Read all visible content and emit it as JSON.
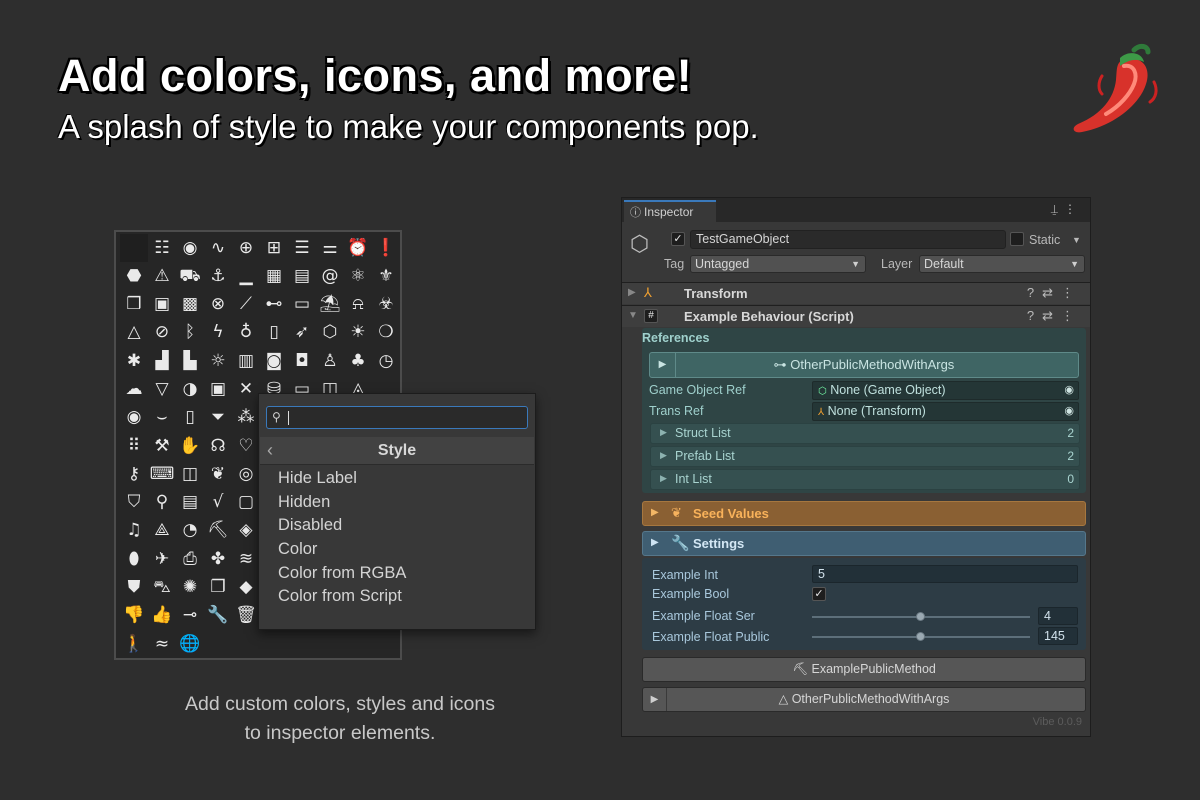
{
  "hero": {
    "title": "Add colors, icons, and more!",
    "subtitle": "A splash of style to make your components pop."
  },
  "caption": {
    "line1": "Add custom colors, styles and icons",
    "line2": "to inspector elements."
  },
  "icon_grid": {
    "icons": [
      {
        "name": "blank-icon",
        "glyph": ""
      },
      {
        "name": "abacus-icon",
        "glyph": "☷"
      },
      {
        "name": "broadcast-icon",
        "glyph": "◉"
      },
      {
        "name": "activity-icon",
        "glyph": "∿"
      },
      {
        "name": "add-circle-icon",
        "glyph": "⊕"
      },
      {
        "name": "add-box-icon",
        "glyph": "⊞"
      },
      {
        "name": "playlist-add-icon",
        "glyph": "☰"
      },
      {
        "name": "sliders-icon",
        "glyph": "⚌"
      },
      {
        "name": "alarm-icon",
        "glyph": "⏰"
      },
      {
        "name": "alert-circle-icon",
        "glyph": "❗"
      },
      {
        "name": "alert-octagon-icon",
        "glyph": "⬣"
      },
      {
        "name": "warning-icon",
        "glyph": "⚠"
      },
      {
        "name": "ambulance-icon",
        "glyph": "⛟"
      },
      {
        "name": "anchor-icon",
        "glyph": "⚓"
      },
      {
        "name": "signal-bars-icon",
        "glyph": "▁"
      },
      {
        "name": "apps-icon",
        "glyph": "▦"
      },
      {
        "name": "archive-icon",
        "glyph": "▤"
      },
      {
        "name": "at-sign-icon",
        "glyph": "@"
      },
      {
        "name": "atom-icon",
        "glyph": "⚛"
      },
      {
        "name": "award-icon",
        "glyph": "⚜"
      },
      {
        "name": "badge-3d-icon",
        "glyph": "❒"
      },
      {
        "name": "badge-ar-icon",
        "glyph": "▣"
      },
      {
        "name": "badge-vr-icon",
        "glyph": "▩"
      },
      {
        "name": "basketball-icon",
        "glyph": "⊗"
      },
      {
        "name": "bandage-icon",
        "glyph": "⟋"
      },
      {
        "name": "barbell-icon",
        "glyph": "⊷"
      },
      {
        "name": "battery-icon",
        "glyph": "▭"
      },
      {
        "name": "beach-icon",
        "glyph": "⛱"
      },
      {
        "name": "bell-ringing-icon",
        "glyph": "⍾"
      },
      {
        "name": "biohazard-icon",
        "glyph": "☣"
      },
      {
        "name": "triangle-icon",
        "glyph": "△"
      },
      {
        "name": "ban-icon",
        "glyph": "⊘"
      },
      {
        "name": "bluetooth-icon",
        "glyph": "ᛒ"
      },
      {
        "name": "bolt-icon",
        "glyph": "ϟ"
      },
      {
        "name": "bomb-icon",
        "glyph": "♁"
      },
      {
        "name": "book-icon",
        "glyph": "▯"
      },
      {
        "name": "rocket-icon",
        "glyph": "➶"
      },
      {
        "name": "box-icon",
        "glyph": "⬡"
      },
      {
        "name": "brightness-icon",
        "glyph": "☀"
      },
      {
        "name": "chat-bubble-icon",
        "glyph": "❍"
      },
      {
        "name": "bug-icon",
        "glyph": "✱"
      },
      {
        "name": "buildings-icon",
        "glyph": "▟"
      },
      {
        "name": "factory-icon",
        "glyph": "▙"
      },
      {
        "name": "bulb-icon",
        "glyph": "☼"
      },
      {
        "name": "calendar-icon",
        "glyph": "▥"
      },
      {
        "name": "camera-icon",
        "glyph": "◙"
      },
      {
        "name": "gamepad-icon",
        "glyph": "◘"
      },
      {
        "name": "chess-pawn-icon",
        "glyph": "♙"
      },
      {
        "name": "tree-icon",
        "glyph": "♣"
      },
      {
        "name": "clock-icon",
        "glyph": "◷"
      },
      {
        "name": "cloud-icon",
        "glyph": "☁"
      },
      {
        "name": "funnel-down-icon",
        "glyph": "▽"
      },
      {
        "name": "contrast-icon",
        "glyph": "◑"
      },
      {
        "name": "cpu-icon",
        "glyph": "▣"
      },
      {
        "name": "close-icon",
        "glyph": "✕"
      },
      {
        "name": "database-icon",
        "glyph": "⛁"
      },
      {
        "name": "desktop-icon",
        "glyph": "▭"
      },
      {
        "name": "ticket-icon",
        "glyph": "◫"
      },
      {
        "name": "droplet-icon",
        "glyph": "◬"
      },
      {
        "name": "blank-2-icon",
        "glyph": ""
      },
      {
        "name": "eye-icon",
        "glyph": "◉"
      },
      {
        "name": "eye-closed-icon",
        "glyph": "⌣"
      },
      {
        "name": "file-icon",
        "glyph": "▯"
      },
      {
        "name": "filter-icon",
        "glyph": "⏷"
      },
      {
        "name": "shapes-icon",
        "glyph": "⁂"
      },
      {
        "name": "blank-3-icon",
        "glyph": ""
      },
      {
        "name": "blank-4-icon",
        "glyph": ""
      },
      {
        "name": "blank-5-icon",
        "glyph": ""
      },
      {
        "name": "blank-6-icon",
        "glyph": ""
      },
      {
        "name": "blank-7-icon",
        "glyph": ""
      },
      {
        "name": "grid-dots-icon",
        "glyph": "⠿"
      },
      {
        "name": "gavel-icon",
        "glyph": "⚒"
      },
      {
        "name": "hand-icon",
        "glyph": "✋"
      },
      {
        "name": "headphones-icon",
        "glyph": "☊"
      },
      {
        "name": "heart-icon",
        "glyph": "♡"
      },
      {
        "name": "blank-8-icon",
        "glyph": ""
      },
      {
        "name": "blank-9-icon",
        "glyph": ""
      },
      {
        "name": "blank-10-icon",
        "glyph": ""
      },
      {
        "name": "blank-11-icon",
        "glyph": ""
      },
      {
        "name": "blank-12-icon",
        "glyph": ""
      },
      {
        "name": "key-icon",
        "glyph": "⚷"
      },
      {
        "name": "keyboard-icon",
        "glyph": "⌨"
      },
      {
        "name": "layout-columns-icon",
        "glyph": "◫"
      },
      {
        "name": "leaf-icon",
        "glyph": "❦"
      },
      {
        "name": "lifebuoy-icon",
        "glyph": "◎"
      },
      {
        "name": "blank-13-icon",
        "glyph": ""
      },
      {
        "name": "blank-14-icon",
        "glyph": ""
      },
      {
        "name": "blank-15-icon",
        "glyph": ""
      },
      {
        "name": "blank-16-icon",
        "glyph": ""
      },
      {
        "name": "blank-17-icon",
        "glyph": ""
      },
      {
        "name": "map-icon",
        "glyph": "⛉"
      },
      {
        "name": "map-pin-icon",
        "glyph": "⚲"
      },
      {
        "name": "message-language-icon",
        "glyph": "▤"
      },
      {
        "name": "math-icon",
        "glyph": "√"
      },
      {
        "name": "message-icon",
        "glyph": "▢"
      },
      {
        "name": "blank-18-icon",
        "glyph": ""
      },
      {
        "name": "blank-19-icon",
        "glyph": ""
      },
      {
        "name": "blank-20-icon",
        "glyph": ""
      },
      {
        "name": "blank-21-icon",
        "glyph": ""
      },
      {
        "name": "blank-22-icon",
        "glyph": ""
      },
      {
        "name": "music-icon",
        "glyph": "♫"
      },
      {
        "name": "triangle-outline-icon",
        "glyph": "⟁"
      },
      {
        "name": "pacman-icon",
        "glyph": "◔"
      },
      {
        "name": "paint-roller-icon",
        "glyph": "⛏"
      },
      {
        "name": "diamond-icon",
        "glyph": "◈"
      },
      {
        "name": "blank-23-icon",
        "glyph": ""
      },
      {
        "name": "blank-24-icon",
        "glyph": ""
      },
      {
        "name": "blank-25-icon",
        "glyph": ""
      },
      {
        "name": "blank-26-icon",
        "glyph": ""
      },
      {
        "name": "blank-27-icon",
        "glyph": ""
      },
      {
        "name": "pill-icon",
        "glyph": "⬮"
      },
      {
        "name": "plane-icon",
        "glyph": "✈"
      },
      {
        "name": "printer-icon",
        "glyph": "⎙"
      },
      {
        "name": "puzzle-icon",
        "glyph": "✤"
      },
      {
        "name": "wave-icon",
        "glyph": "≋"
      },
      {
        "name": "blank-28-icon",
        "glyph": ""
      },
      {
        "name": "blank-29-icon",
        "glyph": ""
      },
      {
        "name": "blank-30-icon",
        "glyph": ""
      },
      {
        "name": "blank-31-icon",
        "glyph": ""
      },
      {
        "name": "blank-32-icon",
        "glyph": ""
      },
      {
        "name": "shirt-icon",
        "glyph": "⛊"
      },
      {
        "name": "shopping-cart-icon",
        "glyph": "⛍"
      },
      {
        "name": "spider-icon",
        "glyph": "✺"
      },
      {
        "name": "copy-icon",
        "glyph": "❐"
      },
      {
        "name": "stack-icon",
        "glyph": "◆"
      },
      {
        "name": "blank-33-icon",
        "glyph": ""
      },
      {
        "name": "blank-34-icon",
        "glyph": ""
      },
      {
        "name": "blank-35-icon",
        "glyph": ""
      },
      {
        "name": "blank-36-icon",
        "glyph": ""
      },
      {
        "name": "blank-37-icon",
        "glyph": ""
      },
      {
        "name": "thumb-down-icon",
        "glyph": "👎"
      },
      {
        "name": "thumb-up-icon",
        "glyph": "👍"
      },
      {
        "name": "toggle-icon",
        "glyph": "⊸"
      },
      {
        "name": "wrench-icon",
        "glyph": "🔧"
      },
      {
        "name": "trash-icon",
        "glyph": "🗑"
      },
      {
        "name": "blank-38-icon",
        "glyph": ""
      },
      {
        "name": "blank-39-icon",
        "glyph": ""
      },
      {
        "name": "blank-40-icon",
        "glyph": ""
      },
      {
        "name": "blank-41-icon",
        "glyph": ""
      },
      {
        "name": "blank-42-icon",
        "glyph": ""
      },
      {
        "name": "walk-icon",
        "glyph": "🚶"
      },
      {
        "name": "wind-icon",
        "glyph": "≈"
      },
      {
        "name": "world-icon",
        "glyph": "🌐"
      }
    ]
  },
  "popup": {
    "header": "Style",
    "items": [
      "Hide Label",
      "Hidden",
      "Disabled",
      "Color",
      "Color from RGBA",
      "Color from Script"
    ]
  },
  "inspector": {
    "tab_label": "Inspector",
    "object_name": "TestGameObject",
    "static_label": "Static",
    "tag_label": "Tag",
    "tag_value": "Untagged",
    "layer_label": "Layer",
    "layer_value": "Default",
    "transform_label": "Transform",
    "behaviour_label": "Example Behaviour (Script)",
    "references_title": "References",
    "method_button_top": "OtherPublicMethodWithArgs",
    "game_object_ref_label": "Game Object Ref",
    "game_object_ref_value": "None (Game Object)",
    "trans_ref_label": "Trans Ref",
    "trans_ref_value": "None (Transform)",
    "lists": [
      {
        "label": "Struct List",
        "count": "2"
      },
      {
        "label": "Prefab List",
        "count": "2"
      },
      {
        "label": "Int List",
        "count": "0"
      }
    ],
    "seed_values_label": "Seed Values",
    "settings_label": "Settings",
    "example_int_label": "Example Int",
    "example_int_value": "5",
    "example_bool_label": "Example Bool",
    "example_float_ser_label": "Example Float Ser",
    "example_float_ser_value": "4",
    "example_float_public_label": "Example Float Public",
    "example_float_public_value": "145",
    "example_public_method": "ExamplePublicMethod",
    "method_button_bottom": "OtherPublicMethodWithArgs",
    "version": "Vibe 0.0.9"
  },
  "colors": {
    "background": "#2e2e2e",
    "teal_section": "#2f4545",
    "seed_orange": "#8a6033",
    "settings_blue": "#3f5e72",
    "accent_blue": "#3a79bb"
  }
}
